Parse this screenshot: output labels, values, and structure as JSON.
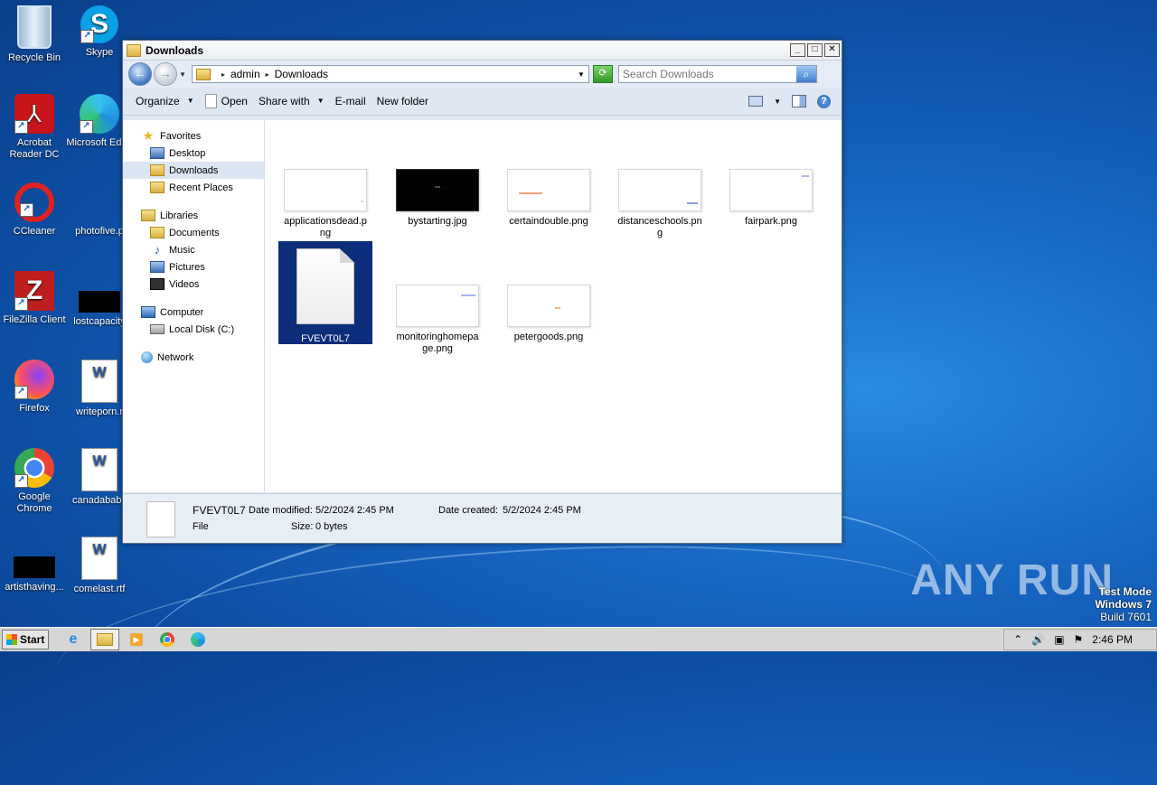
{
  "desktop": {
    "icons": [
      {
        "label": "Recycle Bin"
      },
      {
        "label": "Skype"
      },
      {
        "label": "Acrobat Reader DC"
      },
      {
        "label": "Microsoft Edge"
      },
      {
        "label": "CCleaner"
      },
      {
        "label": "photofive.p"
      },
      {
        "label": "FileZilla Client"
      },
      {
        "label": "lostcapacity"
      },
      {
        "label": "Firefox"
      },
      {
        "label": "writeporn.r"
      },
      {
        "label": "Google Chrome"
      },
      {
        "label": "canadababy"
      },
      {
        "label": "artisthaving..."
      },
      {
        "label": "comelast.rtf"
      }
    ]
  },
  "window": {
    "title": "Downloads",
    "address": {
      "crumbs": [
        "admin",
        "Downloads"
      ]
    },
    "search": {
      "placeholder": "Search Downloads"
    },
    "toolbar": {
      "organize": "Organize",
      "open": "Open",
      "share_with": "Share with",
      "email": "E-mail",
      "new_folder": "New folder"
    },
    "nav": {
      "favorites": "Favorites",
      "desktop": "Desktop",
      "downloads": "Downloads",
      "recent_places": "Recent Places",
      "libraries": "Libraries",
      "documents": "Documents",
      "music": "Music",
      "pictures": "Pictures",
      "videos": "Videos",
      "computer": "Computer",
      "local_disk": "Local Disk (C:)",
      "network": "Network"
    },
    "files": [
      {
        "name": "applicationsdead.png"
      },
      {
        "name": "bystarting.jpg"
      },
      {
        "name": "certaindouble.png"
      },
      {
        "name": "distanceschools.png"
      },
      {
        "name": "fairpark.png"
      },
      {
        "name": "FVEVT0L7"
      },
      {
        "name": "monitoringhomepage.png"
      },
      {
        "name": "petergoods.png"
      }
    ],
    "details": {
      "name": "FVEVT0L7",
      "type": "File",
      "date_modified_label": "Date modified:",
      "date_modified": "5/2/2024 2:45 PM",
      "date_created_label": "Date created:",
      "date_created": "5/2/2024 2:45 PM",
      "size_label": "Size:",
      "size": "0 bytes"
    }
  },
  "taskbar": {
    "start": "Start",
    "clock": "2:46 PM"
  },
  "watermark": {
    "brand": "ANY RUN",
    "test_mode": "Test Mode",
    "os": "Windows 7",
    "build": "Build 7601"
  },
  "colors": {
    "selection": "#0c2d7a",
    "desktop": "#1766c2"
  }
}
